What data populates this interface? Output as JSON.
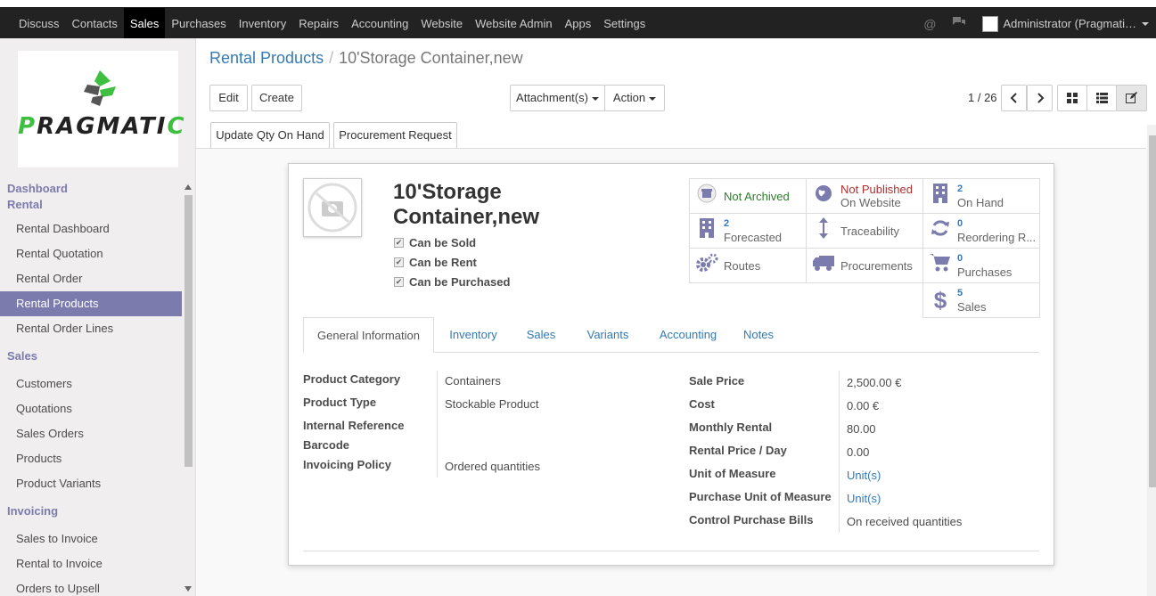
{
  "navbar": {
    "items": [
      "Discuss",
      "Contacts",
      "Sales",
      "Purchases",
      "Inventory",
      "Repairs",
      "Accounting",
      "Website",
      "Website Admin",
      "Apps",
      "Settings"
    ],
    "active": "Sales",
    "user": "Administrator (Pragmati…"
  },
  "sidebar": {
    "logo_text": "PRAGMATIC",
    "sections": [
      {
        "title": "Dashboard",
        "items": []
      },
      {
        "title": "Rental",
        "items": [
          "Rental Dashboard",
          "Rental Quotation",
          "Rental Order",
          "Rental Products",
          "Rental Order Lines"
        ]
      },
      {
        "title": "Sales",
        "items": [
          "Customers",
          "Quotations",
          "Sales Orders",
          "Products",
          "Product Variants"
        ]
      },
      {
        "title": "Invoicing",
        "items": [
          "Sales to Invoice",
          "Rental to Invoice",
          "Orders to Upsell"
        ]
      }
    ],
    "active_item": "Rental Products"
  },
  "breadcrumb": {
    "parent": "Rental Products",
    "current": "10'Storage Container,new"
  },
  "buttons": {
    "edit": "Edit",
    "create": "Create",
    "attachments": "Attachment(s)",
    "action": "Action",
    "update_qty": "Update Qty On Hand",
    "procurement": "Procurement Request"
  },
  "pager": "1 / 26",
  "product": {
    "name": "10'Storage Container,new",
    "checks": [
      "Can be Sold",
      "Can be Rent",
      "Can be Purchased"
    ]
  },
  "smart_buttons": [
    {
      "icon": "archive-icon",
      "label": "Not Archived",
      "num": "",
      "color": "#2c7d2c"
    },
    {
      "icon": "globe-icon",
      "label": "Not Published",
      "sub": "On Website",
      "color": "#b03030"
    },
    {
      "icon": "building-icon",
      "num": "2",
      "label": "On Hand"
    },
    {
      "icon": "building-icon",
      "num": "2",
      "label": "Forecasted"
    },
    {
      "icon": "traceability-icon",
      "label": "Traceability"
    },
    {
      "icon": "refresh-icon",
      "num": "0",
      "label": "Reordering R..."
    },
    {
      "icon": "cogs-icon",
      "label": "Routes"
    },
    {
      "icon": "truck-icon",
      "label": "Procurements"
    },
    {
      "icon": "cart-icon",
      "num": "0",
      "label": "Purchases"
    },
    {
      "icon": "dollar-icon",
      "num": "5",
      "label": "Sales"
    }
  ],
  "tabs": [
    "General Information",
    "Inventory",
    "Sales",
    "Variants",
    "Accounting",
    "Notes"
  ],
  "left_fields": [
    {
      "label": "Product Category",
      "value": "Containers"
    },
    {
      "label": "Product Type",
      "value": "Stockable Product"
    },
    {
      "label": "Internal Reference",
      "value": ""
    },
    {
      "label": "Barcode",
      "value": ""
    },
    {
      "label": "Invoicing Policy",
      "value": "Ordered quantities"
    }
  ],
  "right_fields": [
    {
      "label": "Sale Price",
      "value": "2,500.00 €"
    },
    {
      "label": "Cost",
      "value": "0.00 €"
    },
    {
      "label": "Monthly Rental",
      "value": "80.00"
    },
    {
      "label": "Rental Price / Day",
      "value": "0.00"
    },
    {
      "label": "Unit of Measure",
      "value": "Unit(s)"
    },
    {
      "label": "Purchase Unit of Measure",
      "value": "Unit(s)"
    },
    {
      "label": "Control Purchase Bills",
      "value": "On received quantities"
    }
  ]
}
